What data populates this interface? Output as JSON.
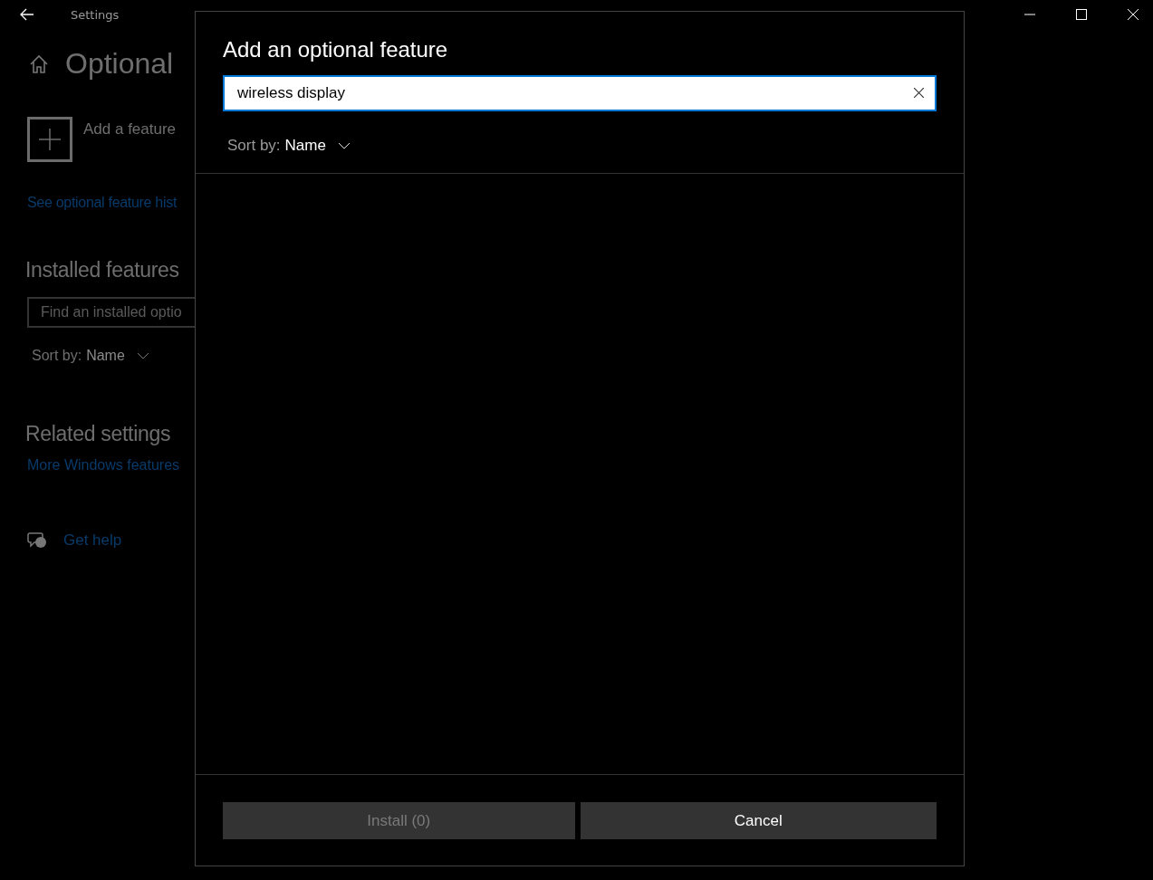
{
  "window": {
    "title": "Settings"
  },
  "page": {
    "heading": "Optional",
    "add_feature": {
      "label": "Add a feature"
    },
    "history_link": "See optional feature hist",
    "installed_heading": "Installed features",
    "installed_search": {
      "placeholder": "Find an installed optio"
    },
    "sort": {
      "label": "Sort by:",
      "value": "Name"
    },
    "related_heading": "Related settings",
    "related_link": "More Windows features",
    "help_link": "Get help"
  },
  "dialog": {
    "title": "Add an optional feature",
    "search": {
      "value": "wireless display",
      "focused": true
    },
    "sort": {
      "label": "Sort by:",
      "value": "Name"
    },
    "buttons": [
      {
        "label": "Install (0)",
        "kind": "primary",
        "disabled": true
      },
      {
        "label": "Cancel",
        "kind": "secondary",
        "disabled": false
      }
    ]
  }
}
